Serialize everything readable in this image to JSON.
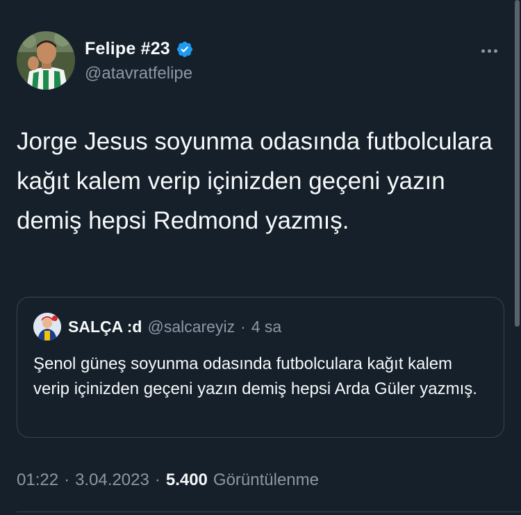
{
  "author": {
    "display_name": "Felipe #23",
    "handle": "@atavratfelipe",
    "verified": true,
    "avatar_icon": "player-avatar",
    "verified_icon": "verified-badge-icon"
  },
  "more_icon": "more-options-icon",
  "tweet": {
    "text": "Jorge Jesus soyunma odasında futbolculara kağıt kalem verip içinizden geçeni yazın demiş hepsi Redmond yazmış."
  },
  "quoted": {
    "display_name": "SALÇA :d",
    "handle": "@salcareyiz",
    "separator": "·",
    "time": "4 sa",
    "avatar_icon": "fan-avatar",
    "text": "Şenol güneş soyunma odasında futbolculara kağıt kalem verip içinizden geçeni yazın demiş hepsi Arda Güler yazmış."
  },
  "meta": {
    "time": "01:22",
    "separator": "·",
    "date": "3.04.2023",
    "views_count": "5.400",
    "views_label": "Görüntülenme"
  },
  "colors": {
    "background": "#15202b",
    "text_primary": "#f7f9f9",
    "text_secondary": "#8b98a5",
    "border": "#38444d",
    "verified_blue": "#1d9bf0"
  }
}
